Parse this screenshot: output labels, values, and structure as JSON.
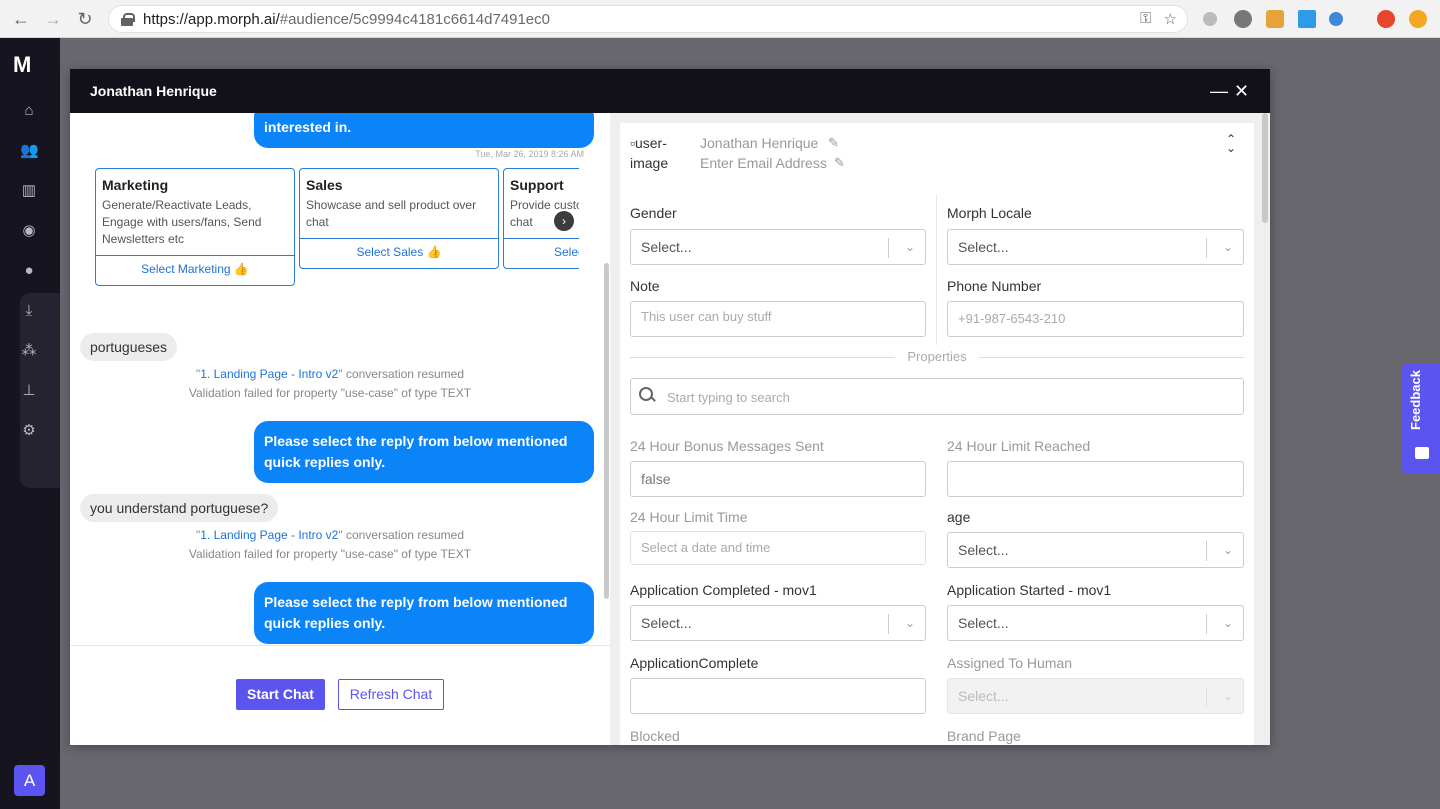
{
  "browser": {
    "url_domain": "https://app.morph.ai/",
    "url_path": "#audience/5c9994c4181c6614d7491ec0"
  },
  "sidebar": {
    "logo": "ʍ",
    "avatar_letter": "A"
  },
  "modal": {
    "title": "Jonathan Henrique"
  },
  "chat": {
    "top_bubble": "interested in.",
    "timestamp": "Tue, Mar 26, 2019 8:26 AM",
    "cards": [
      {
        "title": "Marketing",
        "desc": "Generate/Reactivate Leads, Engage with users/fans, Send Newsletters etc",
        "button": "Select Marketing 👍"
      },
      {
        "title": "Sales",
        "desc": "Showcase and sell product over chat",
        "button": "Select Sales 👍"
      },
      {
        "title": "Support",
        "desc": "Provide customer support over chat",
        "button": "Select Support 👍"
      }
    ],
    "user_msg_1": "portugueses",
    "sys_1_quote_open": "\"",
    "sys_1_link": "1. Landing Page - Intro v2",
    "sys_1_quote_close": "\"",
    "sys_1_suffix": " conversation resumed",
    "sys_1_validation": "Validation failed for property \"use-case\" of type TEXT",
    "bot_msg_1": "Please select the reply from below mentioned quick replies only.",
    "user_msg_2": "you understand portuguese?",
    "sys_2_link": "1. Landing Page - Intro v2",
    "sys_2_suffix": " conversation resumed",
    "sys_2_validation": "Validation failed for property \"use-case\" of type TEXT",
    "bot_msg_2": "Please select the reply from below mentioned quick replies only.",
    "start_chat": "Start Chat",
    "refresh_chat": "Refresh Chat"
  },
  "profile": {
    "image_alt": "user-image",
    "name": "Jonathan Henrique",
    "email_placeholder": "Enter Email Address",
    "gender_label": "Gender",
    "gender_value": "Select...",
    "locale_label": "Morph Locale",
    "locale_value": "Select...",
    "note_label": "Note",
    "note_placeholder": "This user can buy stuff",
    "phone_label": "Phone Number",
    "phone_placeholder": "+91-987-6543-210",
    "properties_title": "Properties",
    "search_placeholder": "Start typing to search",
    "fields": {
      "bonus_label": "24 Hour Bonus Messages Sent",
      "bonus_value": "false",
      "limit_reached_label": "24 Hour Limit Reached",
      "limit_time_label": "24 Hour Limit Time",
      "limit_time_placeholder": "Select a date and time",
      "age_label": "age",
      "age_value": "Select...",
      "app_completed_label": "Application Completed - mov1",
      "app_completed_value": "Select...",
      "app_started_label": "Application Started - mov1",
      "app_started_value": "Select...",
      "appcomplete_label": "ApplicationComplete",
      "assigned_label": "Assigned To Human",
      "assigned_value": "Select...",
      "blocked_label": "Blocked",
      "brand_label": "Brand Page"
    }
  },
  "feedback": {
    "label": "Feedback"
  },
  "colors": {
    "accent": "#5b54ef",
    "bot_bubble": "#0a84f7",
    "sidebar_bg": "#15141f",
    "modal_header": "#121119"
  }
}
